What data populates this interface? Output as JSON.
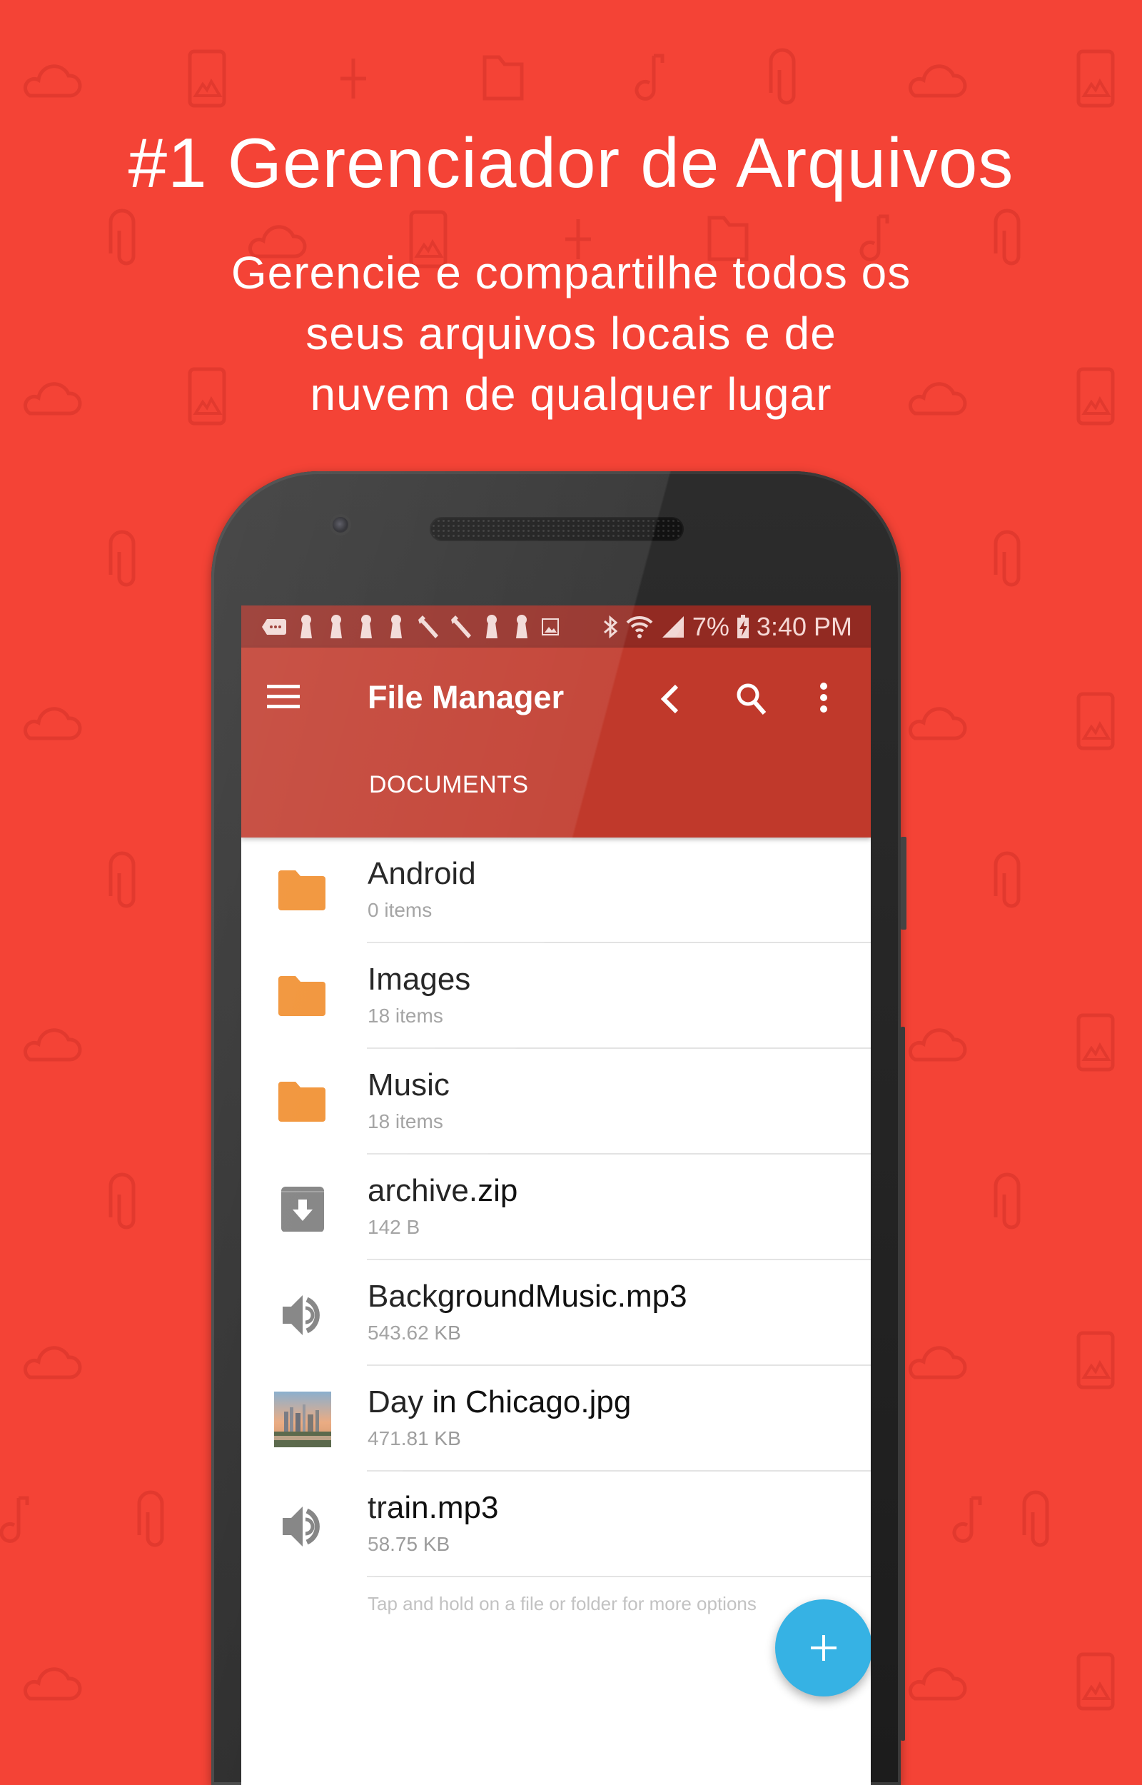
{
  "promo": {
    "headline": "#1 Gerenciador de Arquivos",
    "subhead_lines": [
      "Gerencie e compartilhe todos os",
      "seus arquivos locais e de",
      "nuvem de qualquer lugar"
    ]
  },
  "colors": {
    "background": "#f44336",
    "app_bar": "#c0392b",
    "status_bar": "#922a22",
    "folder": "#f08c2a",
    "fab": "#36b2e4",
    "file_icon_gray": "#7b7b7b"
  },
  "background_pattern_icons": [
    "cloud-icon",
    "image-icon",
    "plus-icon",
    "folder-icon",
    "music-note-icon",
    "paperclip-icon"
  ],
  "status_bar": {
    "notification_icons": [
      "message-icon",
      "keyhole-icon",
      "keyhole-icon",
      "keyhole-icon",
      "keyhole-icon",
      "wrench-icon",
      "wrench-icon",
      "keyhole-icon",
      "keyhole-icon",
      "image-icon"
    ],
    "system_icons": [
      "bluetooth-icon",
      "wifi-icon",
      "signal-icon"
    ],
    "battery": "7%",
    "time": "3:40 PM"
  },
  "app_bar": {
    "title": "File Manager",
    "tab": "DOCUMENTS",
    "actions": [
      "back-icon",
      "search-icon",
      "more-vert-icon"
    ]
  },
  "files": [
    {
      "name": "Android",
      "meta": "0 items",
      "type": "folder"
    },
    {
      "name": "Images",
      "meta": "18 items",
      "type": "folder"
    },
    {
      "name": "Music",
      "meta": "18 items",
      "type": "folder"
    },
    {
      "name": "archive.zip",
      "meta": "142 B",
      "type": "archive"
    },
    {
      "name": "BackgroundMusic.mp3",
      "meta": "543.62 KB",
      "type": "audio"
    },
    {
      "name": "Day in Chicago.jpg",
      "meta": "471.81 KB",
      "type": "image"
    },
    {
      "name": "train.mp3",
      "meta": "58.75 KB",
      "type": "audio"
    }
  ],
  "hint": "Tap and hold on a file or folder for more options",
  "fab": {
    "icon": "plus-icon",
    "label": "+"
  }
}
